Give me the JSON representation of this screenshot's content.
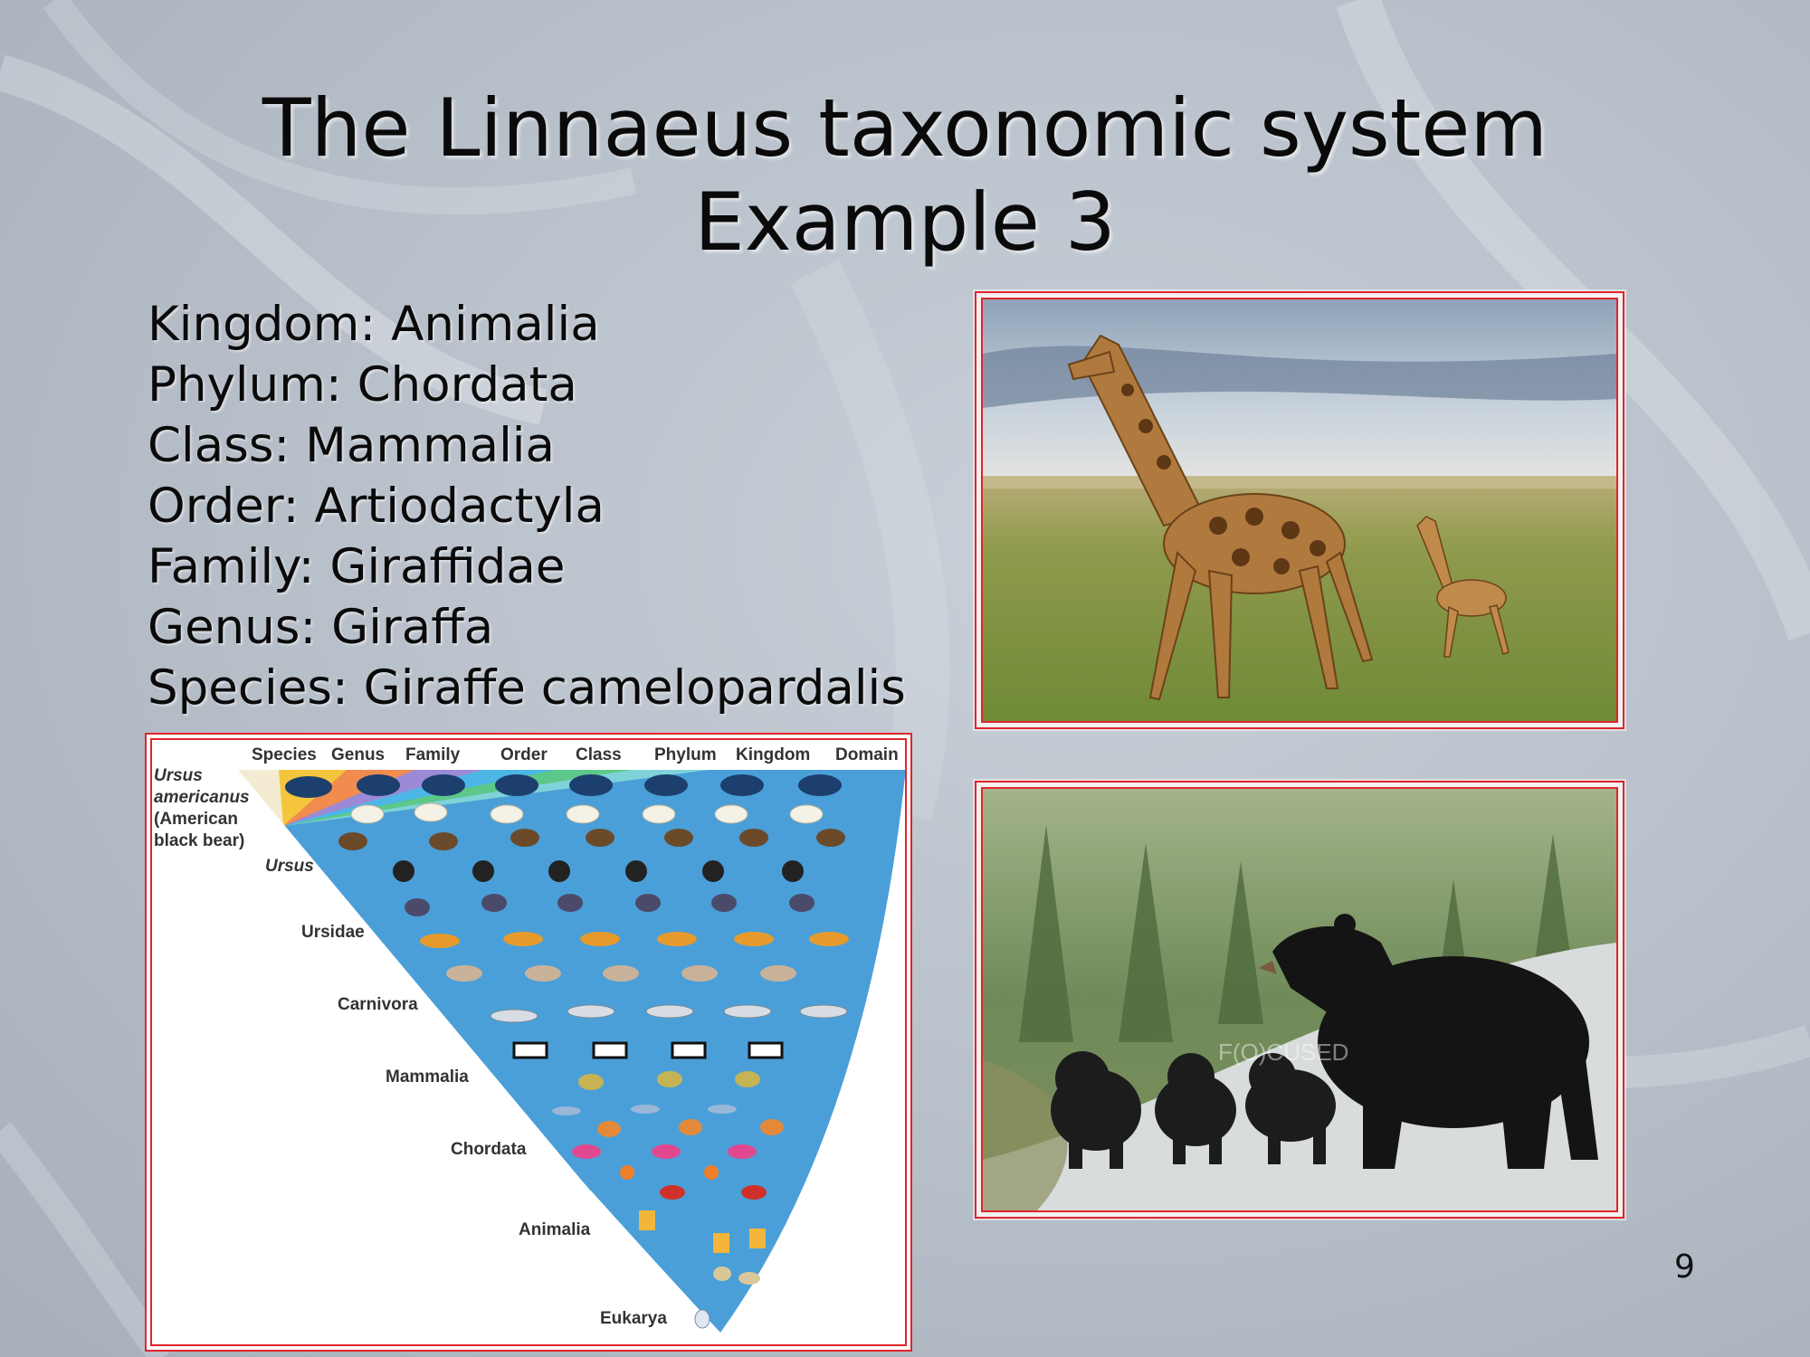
{
  "slide": {
    "title_line1": "The Linnaeus taxonomic system",
    "title_line2": "Example 3",
    "page_number": "9"
  },
  "taxonomy": [
    "Kingdom: Animalia",
    "Phylum: Chordata",
    "Class: Mammalia",
    "Order: Artiodactyla",
    "Family: Giraffidae",
    "Genus: Giraffa",
    "Species: Giraffe camelopardalis"
  ],
  "diagram": {
    "headers": [
      "Species",
      "Genus",
      "Family",
      "Order",
      "Class",
      "Phylum",
      "Kingdom",
      "Domain"
    ],
    "species_label": [
      "Ursus",
      "americanus",
      "(American",
      "black bear)"
    ],
    "levels": [
      "Ursus",
      "Ursidae",
      "Carnivora",
      "Mammalia",
      "Chordata",
      "Animalia",
      "Eukarya"
    ],
    "band_colors": [
      "#f3ecd2",
      "#f5c53c",
      "#f28b4e",
      "#9c8ad6",
      "#4cb7e6",
      "#5cc88a",
      "#7fd3d8",
      "#4a9fd8"
    ]
  },
  "photos": {
    "bear_watermark": "F(O)CUSED"
  }
}
